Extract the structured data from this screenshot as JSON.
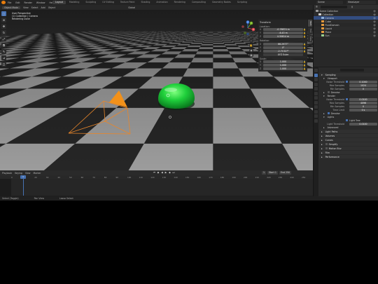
{
  "menubar": {
    "items": [
      "File",
      "Edit",
      "Render",
      "Window",
      "Help"
    ],
    "workspaces": [
      "Layout",
      "Modeling",
      "Sculpting",
      "UV Editing",
      "Texture Paint",
      "Shading",
      "Animation",
      "Rendering",
      "Compositing",
      "Geometry Nodes",
      "Scripting"
    ],
    "active_workspace": "Layout",
    "scene": "Scene",
    "view_layer": "ViewLayer"
  },
  "viewport": {
    "header": {
      "mode": "Object Mode",
      "view": "View",
      "select": "Select",
      "add": "Add",
      "object": "Object",
      "orientation": "Global"
    },
    "info": {
      "line1": "User Perspective",
      "line2": "(1) Collection | Camera",
      "line3": "Rendering Done"
    },
    "tools": [
      "select-icon",
      "cursor-icon",
      "move-icon",
      "rotate-icon",
      "scale-icon",
      "transform-icon",
      "annotate-icon",
      "measure-icon",
      "add-cube-icon"
    ],
    "gizmo": {
      "x": "X",
      "y": "Y",
      "z": "Z"
    },
    "nav": [
      "zoom-icon",
      "pan-icon",
      "camera-view-icon",
      "ortho-icon"
    ]
  },
  "npanel": {
    "title": "Transform",
    "location": {
      "label": "Location:",
      "x": "-0.78874 m",
      "y": "-6.43 m",
      "z": "4.30814 m"
    },
    "rotation": {
      "label": "Rotation:",
      "x": "66.2977°",
      "y": "0°",
      "z": "-2.71327°",
      "mode": "XYZ Euler"
    },
    "scale": {
      "label": "Scale:",
      "x": "1.000",
      "y": "1.000",
      "z": "1.000"
    },
    "tabs": [
      "Item",
      "Tool",
      "View"
    ]
  },
  "timeline": {
    "header": {
      "playback": "Playback",
      "keying": "Keying",
      "view": "View",
      "marker": "Marker"
    },
    "current_frame": "1",
    "start_label": "Start",
    "start": "1",
    "end_label": "End",
    "end": "250",
    "ticks": [
      "0",
      "10",
      "20",
      "30",
      "40",
      "50",
      "60",
      "70",
      "80",
      "90",
      "100",
      "110",
      "120",
      "130",
      "140",
      "150",
      "160",
      "170",
      "180",
      "190",
      "200",
      "210",
      "220",
      "230",
      "240",
      "250"
    ]
  },
  "statusbar": {
    "s1": "Select (Toggle)",
    "s2": "Pan View",
    "s3": "Lasso Select"
  },
  "outliner": {
    "rows": [
      {
        "label": "Scene Collection",
        "color": "#9a9a9a",
        "indent": 0
      },
      {
        "label": "Collection",
        "color": "#cfcfcf",
        "indent": 1
      },
      {
        "label": "Camera",
        "color": "#8fb0d6",
        "indent": 2,
        "sel": true
      },
      {
        "label": "Cube",
        "color": "#e69a3c",
        "indent": 2
      },
      {
        "label": "FluidDomain",
        "color": "#e69a3c",
        "indent": 2
      },
      {
        "label": "Liquid",
        "color": "#e69a3c",
        "indent": 2
      },
      {
        "label": "Plane",
        "color": "#e69a3c",
        "indent": 2
      },
      {
        "label": "Sun",
        "color": "#9ad08f",
        "indent": 2
      }
    ]
  },
  "properties": {
    "sampling": "Sampling",
    "viewport": "Viewport",
    "noise_threshold_label": "Noise Threshold",
    "vp_noise_threshold": "0.1000",
    "max_samples_label": "Max Samples",
    "vp_max_samples": "1024",
    "min_samples_label": "Min Samples",
    "vp_min_samples": "0",
    "denoise": "Denoise",
    "render": "Render",
    "r_noise_threshold": "0.0100",
    "r_max_samples": "4096",
    "r_min_samples": "0",
    "time_limit_label": "Time Limit",
    "r_time_limit": "0 s",
    "denoise2": "Denoise",
    "lights": "Lights",
    "light_tree": "Light Tree",
    "light_threshold_label": "Light Threshold",
    "light_threshold": "0.0100",
    "advanced": "Advanced",
    "light_paths": "Light Paths",
    "volumes": "Volumes",
    "curves": "Curves",
    "simplify": "Simplify",
    "motion_blur": "Motion Blur",
    "film": "Film",
    "performance": "Performance"
  }
}
